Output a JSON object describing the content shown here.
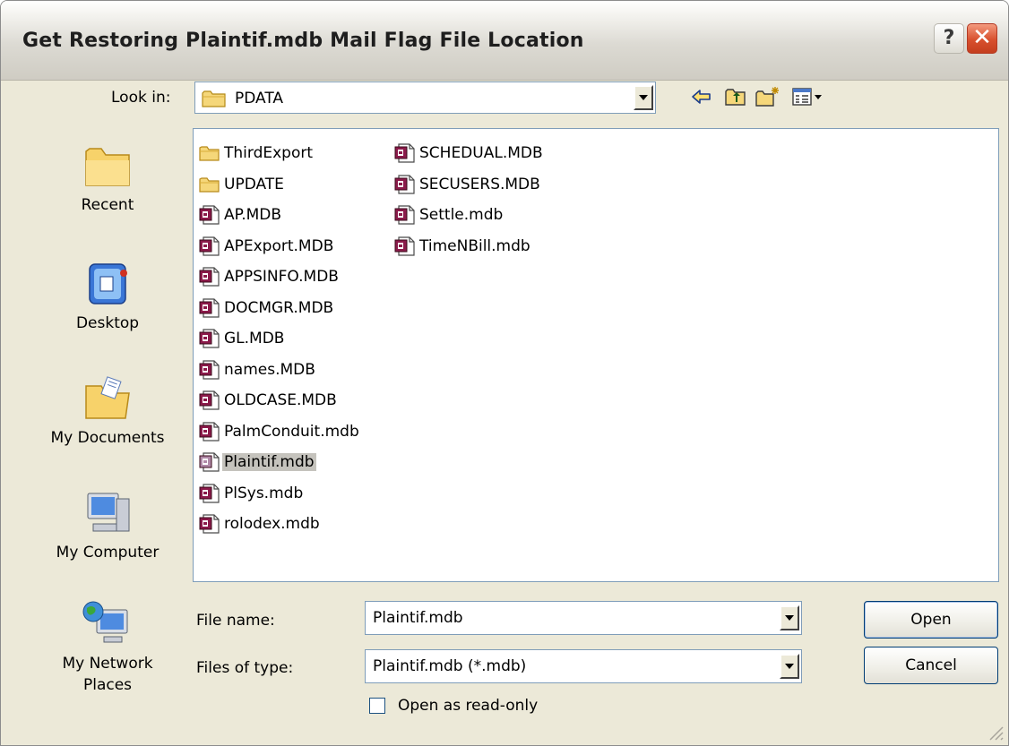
{
  "window": {
    "title": "Get Restoring Plaintif.mdb Mail Flag File Location",
    "help_glyph": "?",
    "close_glyph": "✕"
  },
  "look_in": {
    "label": "Look in:",
    "value": "PDATA"
  },
  "toolbar": {
    "icons": [
      "back-arrow-icon",
      "up-one-level-icon",
      "new-folder-icon",
      "views-menu-icon"
    ]
  },
  "places": [
    {
      "label": "Recent",
      "icon": "recent-folder-icon"
    },
    {
      "label": "Desktop",
      "icon": "desktop-icon"
    },
    {
      "label": "My Documents",
      "icon": "my-documents-icon"
    },
    {
      "label": "My Computer",
      "icon": "my-computer-icon"
    },
    {
      "label": "My Network Places",
      "icon": "network-places-icon"
    }
  ],
  "files": {
    "column1": [
      {
        "name": "ThirdExport",
        "type": "folder"
      },
      {
        "name": "UPDATE",
        "type": "folder"
      },
      {
        "name": "AP.MDB",
        "type": "mdb"
      },
      {
        "name": "APExport.MDB",
        "type": "mdb"
      },
      {
        "name": "APPSINFO.MDB",
        "type": "mdb"
      },
      {
        "name": "DOCMGR.MDB",
        "type": "mdb"
      },
      {
        "name": "GL.MDB",
        "type": "mdb"
      },
      {
        "name": "names.MDB",
        "type": "mdb"
      },
      {
        "name": "OLDCASE.MDB",
        "type": "mdb"
      },
      {
        "name": "PalmConduit.mdb",
        "type": "mdb"
      },
      {
        "name": "Plaintif.mdb",
        "type": "mdb",
        "selected": true
      },
      {
        "name": "PlSys.mdb",
        "type": "mdb"
      },
      {
        "name": "rolodex.mdb",
        "type": "mdb"
      }
    ],
    "column2": [
      {
        "name": "SCHEDUAL.MDB",
        "type": "mdb"
      },
      {
        "name": "SECUSERS.MDB",
        "type": "mdb"
      },
      {
        "name": "Settle.mdb",
        "type": "mdb"
      },
      {
        "name": "TimeNBill.mdb",
        "type": "mdb"
      }
    ]
  },
  "file_name": {
    "label": "File name:",
    "value": "Plaintif.mdb"
  },
  "file_type": {
    "label": "Files of type:",
    "value": "Plaintif.mdb (*.mdb)"
  },
  "read_only": {
    "label": "Open as read-only",
    "checked": false
  },
  "buttons": {
    "open": "Open",
    "cancel": "Cancel"
  }
}
